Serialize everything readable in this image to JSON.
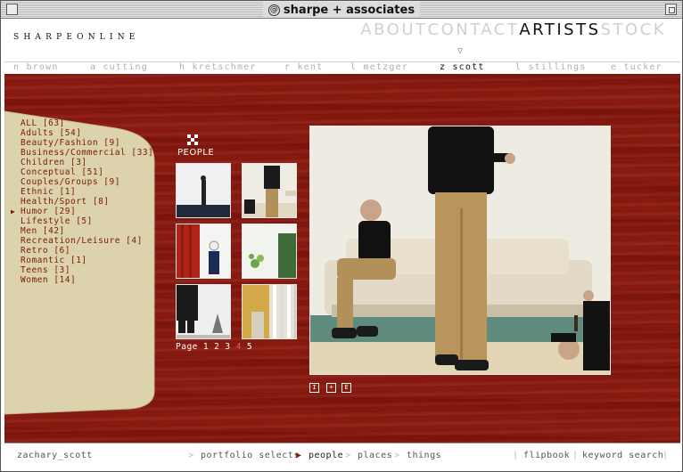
{
  "window": {
    "title": "sharpe + associates"
  },
  "header": {
    "logo": "SHARPEONLINE",
    "nav": [
      {
        "label": "ABOUT",
        "active": false
      },
      {
        "label": "CONTACT",
        "active": false
      },
      {
        "label": "ARTISTS",
        "active": true
      },
      {
        "label": "STOCK",
        "active": false
      }
    ]
  },
  "artists": [
    {
      "label": "n brown",
      "active": false
    },
    {
      "label": "a cutting",
      "active": false
    },
    {
      "label": "h kretschmer",
      "active": false
    },
    {
      "label": "r kent",
      "active": false
    },
    {
      "label": "l metzger",
      "active": false
    },
    {
      "label": "z scott",
      "active": true
    },
    {
      "label": "l stillings",
      "active": false
    },
    {
      "label": "e tucker",
      "active": false
    }
  ],
  "categories": [
    {
      "label": "ALL [63]",
      "selected": false
    },
    {
      "label": "Adults [54]",
      "selected": false
    },
    {
      "label": "Beauty/Fashion [9]",
      "selected": false
    },
    {
      "label": "Business/Commercial [33]",
      "selected": false
    },
    {
      "label": "Children [3]",
      "selected": false
    },
    {
      "label": "Conceptual [51]",
      "selected": false
    },
    {
      "label": "Couples/Groups [9]",
      "selected": false
    },
    {
      "label": "Ethnic [1]",
      "selected": false
    },
    {
      "label": "Health/Sport [8]",
      "selected": false
    },
    {
      "label": "Humor [29]",
      "selected": true
    },
    {
      "label": "Lifestyle [5]",
      "selected": false
    },
    {
      "label": "Men [42]",
      "selected": false
    },
    {
      "label": "Recreation/Leisure [4]",
      "selected": false
    },
    {
      "label": "Retro [6]",
      "selected": false
    },
    {
      "label": "Romantic [1]",
      "selected": false
    },
    {
      "label": "Teens [3]",
      "selected": false
    },
    {
      "label": "Women [14]",
      "selected": false
    }
  ],
  "gallery": {
    "section_title": "PEOPLE",
    "page_label": "Page",
    "pages": [
      "1",
      "2",
      "3",
      "4",
      "5"
    ],
    "current_page": "4"
  },
  "controls": [
    "I",
    "+",
    "E"
  ],
  "footer": {
    "artist_name": "zachary_scott",
    "crumbs": [
      {
        "label": "portfolio selects"
      },
      {
        "label": "people"
      },
      {
        "label": "places"
      },
      {
        "label": "things"
      }
    ],
    "links": [
      "flipbook",
      "keyword search"
    ]
  },
  "colors": {
    "wood": "#8b1a10",
    "tab": "#dcd2ab",
    "accent_text": "#7a1a0a"
  },
  "icons": [
    "people-dots-icon",
    "info-icon",
    "zoom-plus-icon",
    "email-icon",
    "pointer-arrow-icon"
  ]
}
